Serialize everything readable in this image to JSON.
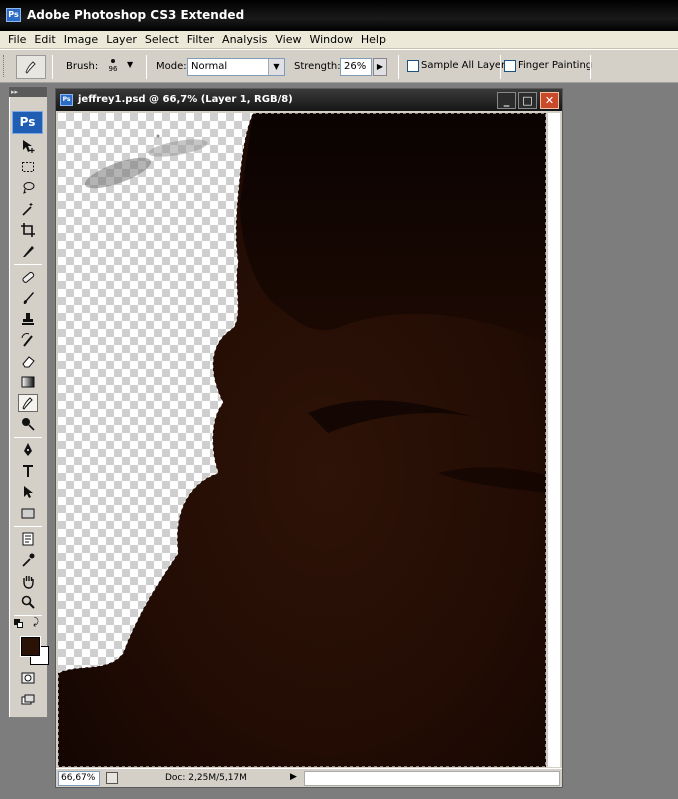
{
  "app": {
    "title": "Adobe Photoshop CS3 Extended",
    "icon_text": "Ps"
  },
  "menu": [
    "File",
    "Edit",
    "Image",
    "Layer",
    "Select",
    "Filter",
    "Analysis",
    "View",
    "Window",
    "Help"
  ],
  "options": {
    "brush_label": "Brush:",
    "brush_size": "96",
    "mode_label": "Mode:",
    "mode_value": "Normal",
    "strength_label": "Strength:",
    "strength_value": "26%",
    "sample_all_layers": {
      "label": "Sample All Layers",
      "checked": false
    },
    "finger_painting": {
      "label": "Finger Painting",
      "checked": false
    }
  },
  "toolbox": {
    "logo": "Ps",
    "foreground_color": "#2a1206",
    "background_color": "#ffffff",
    "active_tool": "smudge-tool"
  },
  "document": {
    "title": "jeffrey1.psd @ 66,7% (Layer 1, RGB/8)",
    "icon_text": "Ps",
    "zoom": "66,67%",
    "doc_info": "Doc: 2,25M/5,17M"
  },
  "colors": {
    "photo_dark": "#1a0a04",
    "photo_mid": "#2c1206",
    "window_chrome": "#d4d0c8"
  }
}
